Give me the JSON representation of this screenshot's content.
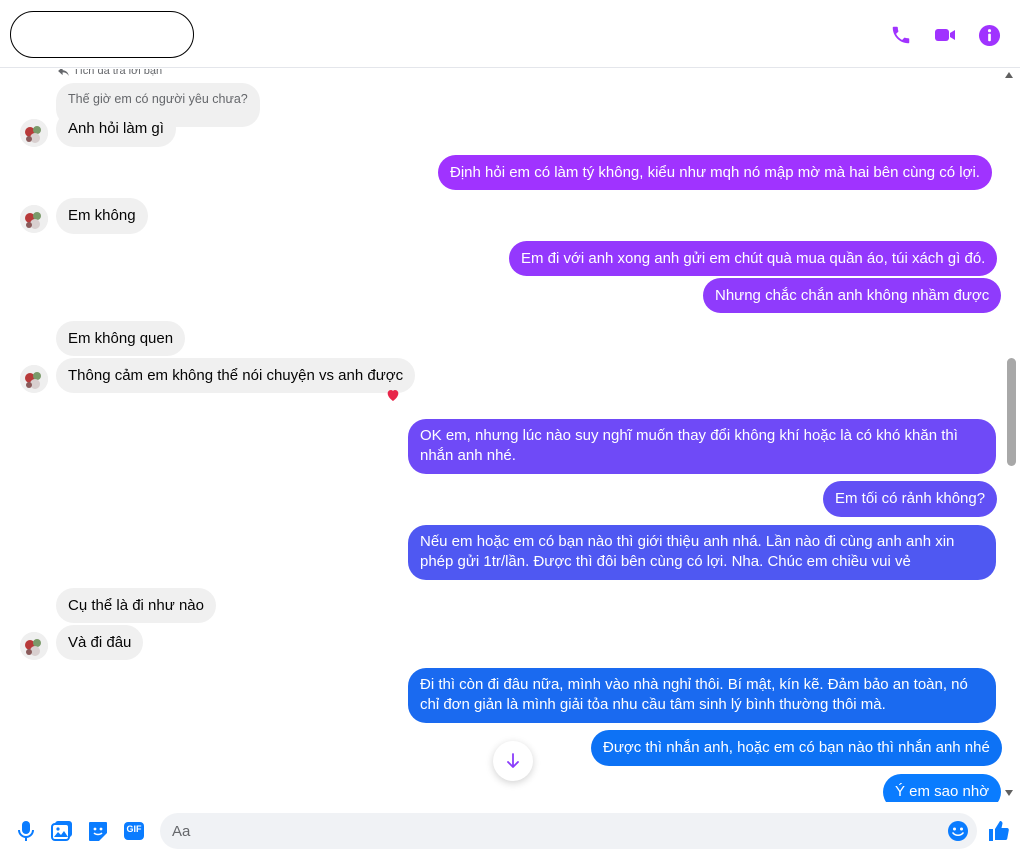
{
  "header": {
    "name": "",
    "icons": [
      "phone-icon",
      "video-camera-icon",
      "info-icon"
    ],
    "accent": "#a033ff"
  },
  "thread": {
    "reply_note": "Tích đã trả lời bạn",
    "reply_quote": "Thế giờ em có người yêu chưa?",
    "messages": [
      {
        "side": "in",
        "text": "Anh hỏi làm gì"
      },
      {
        "side": "out",
        "text": "Định hỏi em có làm tý không, kiểu như mqh nó mập mờ mà hai bên cùng có lợi."
      },
      {
        "side": "in",
        "text": "Em không"
      },
      {
        "side": "out",
        "text": "Em đi với anh xong anh gửi em chút quà mua quần áo, túi xách gì đó."
      },
      {
        "side": "out",
        "text": "Nhưng chắc chắn anh không nhầm được"
      },
      {
        "side": "in",
        "text": "Em không quen"
      },
      {
        "side": "in",
        "text": "Thông cảm em không thể nói chuyện vs anh được",
        "reaction": "heart-icon"
      },
      {
        "side": "out",
        "text": "OK em, nhưng lúc nào suy nghĩ muốn thay đổi không khí hoặc là có khó khăn thì nhắn anh nhé."
      },
      {
        "side": "out",
        "text": "Em tối có rảnh không?"
      },
      {
        "side": "out",
        "text": "Nếu em hoặc em có bạn nào thì giới thiệu anh nhá. Lần nào đi cùng anh anh xin phép gửi 1tr/lần. Được thì đôi bên cùng có lợi. Nha. Chúc em chiều vui vẻ"
      },
      {
        "side": "in",
        "text": "Cụ thể là đi như nào"
      },
      {
        "side": "in",
        "text": "Và đi đâu"
      },
      {
        "side": "out",
        "text": "Đi thì còn đi đâu nữa, mình vào nhà nghỉ thôi. Bí mật, kín kẽ. Đảm bảo an toàn, nó chỉ đơn giản là mình giải tỏa nhu cầu tâm sinh lý bình thường thôi mà."
      },
      {
        "side": "out",
        "text": "Được thì nhắn anh, hoặc em có bạn nào thì nhắn anh nhé"
      },
      {
        "side": "out",
        "text": "Ý em sao nhờ"
      }
    ],
    "colors": {
      "incoming_bg": "#f0f0f0",
      "outgoing_gradient": [
        "#a033ff",
        "#8b3cfb",
        "#6a4cf7",
        "#4a5cf0",
        "#1a6cf0",
        "#0a7cff"
      ]
    }
  },
  "composer": {
    "placeholder": "Aa",
    "icons": [
      "microphone-icon",
      "image-icon",
      "sticker-icon",
      "gif-icon",
      "emoji-icon",
      "like-icon"
    ],
    "gif_label": "GIF"
  }
}
